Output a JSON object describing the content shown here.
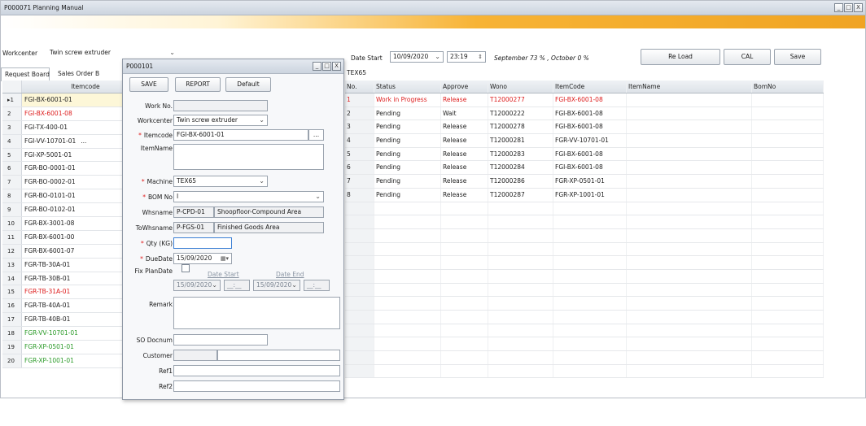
{
  "window": {
    "title": "P000071 Planning Manual",
    "controls": [
      "_",
      "□",
      "X"
    ]
  },
  "header": {
    "workcenter_label": "Workcenter",
    "workcenter_value": "Twin screw extruder",
    "date_start_label": "Date Start",
    "date_value": "10/09/2020",
    "time_value": "23:19",
    "summary_text": "September 73 % , October 0 %",
    "reload_label": "Re Load",
    "cal_label": "CAL",
    "save_label": "Save",
    "machine_tab": "TEX65"
  },
  "tabs": [
    {
      "label": "Request Board",
      "active": true
    },
    {
      "label": "Sales Order B",
      "active": false
    }
  ],
  "left_grid": {
    "header": "Itemcode",
    "rows": [
      {
        "no": "▸1",
        "code": "FGI-BX-6001-01",
        "color": "normal",
        "selected": true
      },
      {
        "no": "2",
        "code": "FGI-BX-6001-08",
        "color": "red"
      },
      {
        "no": "3",
        "code": "FGI-TX-400-01",
        "color": "normal"
      },
      {
        "no": "4",
        "code": "FGI-VV-10701-01",
        "color": "normal",
        "ellipsis": "..."
      },
      {
        "no": "5",
        "code": "FGI-XP-5001-01",
        "color": "normal"
      },
      {
        "no": "6",
        "code": "FGR-BO-0001-01",
        "color": "normal"
      },
      {
        "no": "7",
        "code": "FGR-BO-0002-01",
        "color": "normal"
      },
      {
        "no": "8",
        "code": "FGR-BO-0101-01",
        "color": "normal"
      },
      {
        "no": "9",
        "code": "FGR-BO-0102-01",
        "color": "normal"
      },
      {
        "no": "10",
        "code": "FGR-BX-3001-08",
        "color": "normal"
      },
      {
        "no": "11",
        "code": "FGR-BX-6001-00",
        "color": "normal"
      },
      {
        "no": "12",
        "code": "FGR-BX-6001-07",
        "color": "normal"
      },
      {
        "no": "13",
        "code": "FGR-TB-30A-01",
        "color": "normal"
      },
      {
        "no": "14",
        "code": "FGR-TB-30B-01",
        "color": "normal"
      },
      {
        "no": "15",
        "code": "FGR-TB-31A-01",
        "color": "red"
      },
      {
        "no": "16",
        "code": "FGR-TB-40A-01",
        "color": "normal"
      },
      {
        "no": "17",
        "code": "FGR-TB-40B-01",
        "color": "normal"
      },
      {
        "no": "18",
        "code": "FGR-VV-10701-01",
        "color": "green"
      },
      {
        "no": "19",
        "code": "FGR-XP-0501-01",
        "color": "green"
      },
      {
        "no": "20",
        "code": "FGR-XP-1001-01",
        "color": "green"
      }
    ]
  },
  "right_grid": {
    "columns": [
      "No.",
      "Status",
      "Approve",
      "Wono",
      "ItemCode",
      "ItemName",
      "BomNo"
    ],
    "rows": [
      {
        "no": "1",
        "status": "Work in Progress",
        "approve": "Release",
        "wono": "T12000277",
        "itemcode": "FGI-BX-6001-08",
        "red": true
      },
      {
        "no": "2",
        "status": "Pending",
        "approve": "Wait",
        "wono": "T12000222",
        "itemcode": "FGI-BX-6001-08"
      },
      {
        "no": "3",
        "status": "Pending",
        "approve": "Release",
        "wono": "T12000278",
        "itemcode": "FGI-BX-6001-08"
      },
      {
        "no": "4",
        "status": "Pending",
        "approve": "Release",
        "wono": "T12000281",
        "itemcode": "FGR-VV-10701-01"
      },
      {
        "no": "5",
        "status": "Pending",
        "approve": "Release",
        "wono": "T12000283",
        "itemcode": "FGI-BX-6001-08"
      },
      {
        "no": "6",
        "status": "Pending",
        "approve": "Release",
        "wono": "T12000284",
        "itemcode": "FGI-BX-6001-08"
      },
      {
        "no": "7",
        "status": "Pending",
        "approve": "Release",
        "wono": "T12000286",
        "itemcode": "FGR-XP-0501-01"
      },
      {
        "no": "8",
        "status": "Pending",
        "approve": "Release",
        "wono": "T12000287",
        "itemcode": "FGR-XP-1001-01"
      }
    ]
  },
  "popup": {
    "title": "P000101",
    "buttons": {
      "save": "SAVE",
      "report": "REPORT",
      "default": "Default"
    },
    "workno_label": "Work No.",
    "workno_value": "",
    "workcenter_label": "Workcenter",
    "workcenter_value": "Twin screw extruder",
    "itemcode_label": "Itemcode",
    "itemcode_value": "FGI-BX-6001-01",
    "itemcode_browse": "...",
    "itemname_label": "ItemName",
    "itemname_value": "",
    "machine_label": "Machine",
    "machine_value": "TEX65",
    "bomno_label": "BOM No",
    "bomno_value": "I",
    "whsname_label": "Whsname",
    "whsname_code": "P-CPD-01",
    "whsname_name": "Shoopfloor-Compound Area",
    "towhsname_label": "ToWhsname",
    "towhsname_code": "P-FGS-01",
    "towhsname_name": "Finished Goods Area",
    "qty_label": "Qty (KG)",
    "qty_value": "",
    "duedate_label": "DueDate",
    "duedate_value": "15/09/2020",
    "fixplan_label": "Fix PlanDate",
    "date_start_label": "Date Start",
    "date_end_label": "Date End",
    "plan_start_date": "15/09/2020",
    "plan_start_time": "__:__",
    "plan_end_date": "15/09/2020",
    "plan_end_time": "__:__",
    "remark_label": "Remark",
    "remark_value": "",
    "sodocnum_label": "SO Docnum",
    "customer_label": "Customer",
    "ref1_label": "Ref1",
    "ref2_label": "Ref2",
    "required_mark": "*"
  }
}
